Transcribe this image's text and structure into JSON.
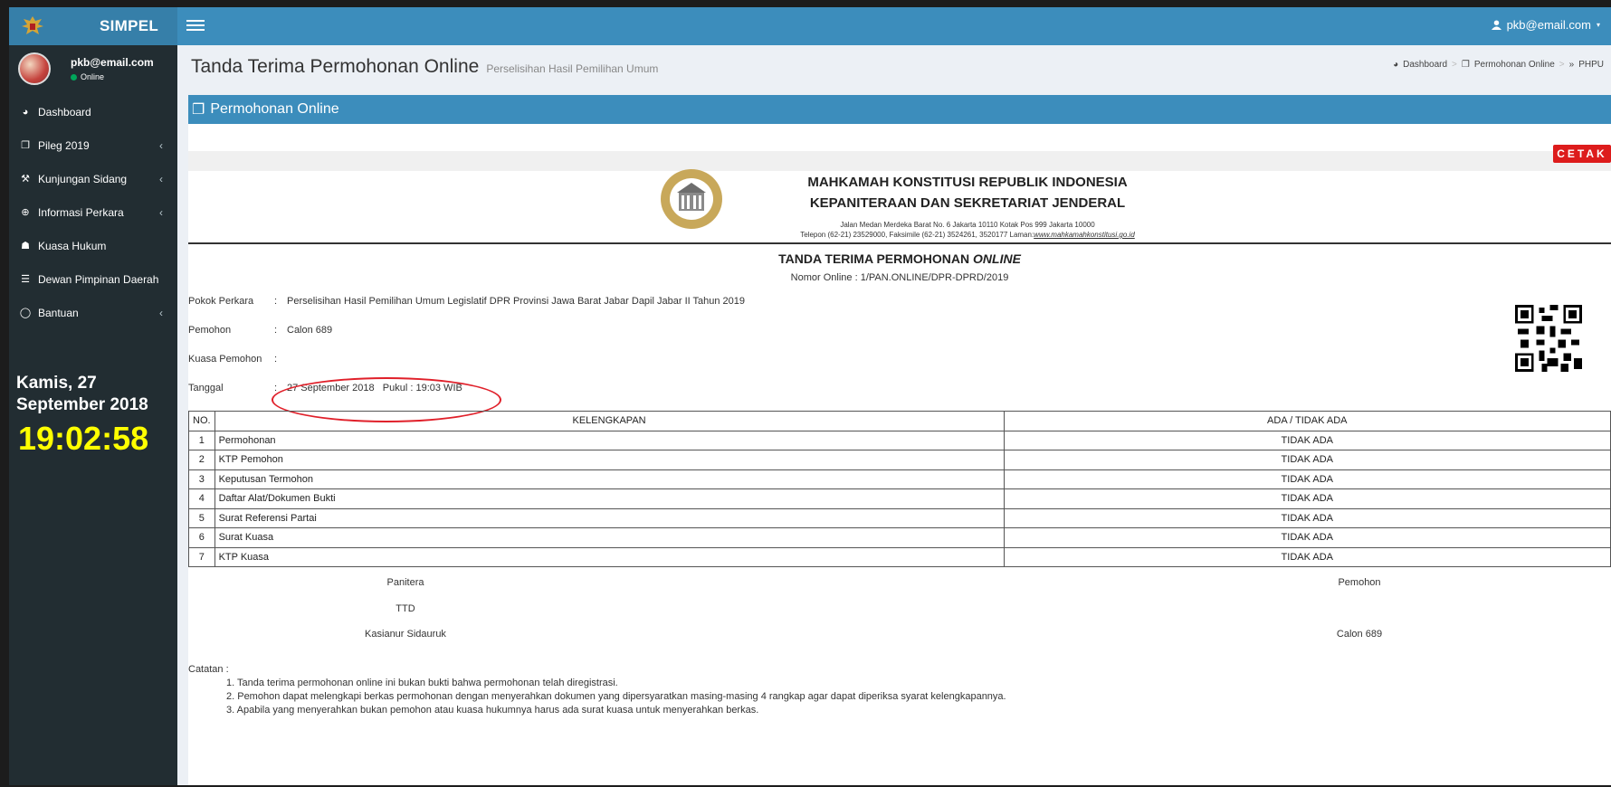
{
  "app": {
    "brand": "SIMPEL"
  },
  "header": {
    "user": "pkb@email.com"
  },
  "sidebar": {
    "user_name": "pkb@email.com",
    "user_status": "Online",
    "items": [
      {
        "label": "Dashboard",
        "icon": "dashboard-icon"
      },
      {
        "label": "Pileg 2019",
        "icon": "copy-icon"
      },
      {
        "label": "Kunjungan Sidang",
        "icon": "gavel-icon"
      },
      {
        "label": "Informasi Perkara",
        "icon": "search-icon"
      },
      {
        "label": "Kuasa Hukum",
        "icon": "users-icon"
      },
      {
        "label": "Dewan Pimpinan Daerah",
        "icon": "list-icon"
      },
      {
        "label": "Bantuan",
        "icon": "chat-icon"
      }
    ],
    "date_line1": "Kamis, 27",
    "date_line2": "September 2018",
    "clock": "19:02:58"
  },
  "page": {
    "title": "Tanda Terima Permohonan Online",
    "subtitle": "Perselisihan Hasil Pemilihan Umum",
    "breadcrumb": [
      "Dashboard",
      "Permohonan Online",
      "PHPU"
    ]
  },
  "box": {
    "title": "Permohonan Online",
    "print_label": "CETAK"
  },
  "doc": {
    "inst_line1": "MAHKAMAH KONSTITUSI REPUBLIK INDONESIA",
    "inst_line2": "KEPANITERAAN DAN SEKRETARIAT JENDERAL",
    "address": "Jalan Medan Merdeka Barat No. 6 Jakarta 10110 Kotak Pos 999 Jakarta 10000",
    "phone": "Telepon (62-21) 23529000, Faksimile (62-21) 3524261, 3520177 Laman:",
    "website": "www.mahkamahkonstitusi.go.id",
    "title_main": "TANDA TERIMA PERMOHONAN ",
    "title_italic": "ONLINE",
    "number": "Nomor Online : 1/PAN.ONLINE/DPR-DPRD/2019",
    "fields": [
      {
        "label": "Pokok Perkara",
        "value": "Perselisihan Hasil Pemilihan Umum Legislatif DPR Provinsi Jawa Barat Jabar Dapil Jabar II Tahun 2019"
      },
      {
        "label": "Pemohon",
        "value": "Calon 689"
      },
      {
        "label": "Kuasa Pemohon",
        "value": ""
      },
      {
        "label": "Tanggal",
        "value": "27 September 2018   Pukul : 19:03 WIB"
      }
    ],
    "table": {
      "headers": [
        "NO.",
        "KELENGKAPAN",
        "ADA / TIDAK ADA"
      ],
      "rows": [
        {
          "no": "1",
          "item": "Permohonan",
          "status": "TIDAK ADA"
        },
        {
          "no": "2",
          "item": "KTP Pemohon",
          "status": "TIDAK ADA"
        },
        {
          "no": "3",
          "item": "Keputusan Termohon",
          "status": "TIDAK ADA"
        },
        {
          "no": "4",
          "item": "Daftar Alat/Dokumen Bukti",
          "status": "TIDAK ADA"
        },
        {
          "no": "5",
          "item": "Surat Referensi Partai",
          "status": "TIDAK ADA"
        },
        {
          "no": "6",
          "item": "Surat Kuasa",
          "status": "TIDAK ADA"
        },
        {
          "no": "7",
          "item": "KTP Kuasa",
          "status": "TIDAK ADA"
        }
      ]
    },
    "signature": {
      "left_title": "Panitera",
      "left_ttd": "TTD",
      "left_name": "Kasianur Sidauruk",
      "right_title": "Pemohon",
      "right_name": "Calon 689"
    },
    "notes_label": "Catatan :",
    "notes": [
      "1. Tanda terima permohonan online ini bukan bukti bahwa permohonan telah diregistrasi.",
      "2. Pemohon dapat melengkapi berkas permohonan dengan menyerahkan dokumen yang dipersyaratkan masing-masing 4 rangkap agar dapat diperiksa syarat kelengkapannya.",
      "3. Apabila yang menyerahkan bukan pemohon atau kuasa hukumnya harus ada surat kuasa untuk menyerahkan berkas."
    ]
  },
  "colors": {
    "header": "#3c8dbc",
    "sidebar": "#222d32",
    "print_button": "#dd1c1c",
    "clock": "#ffff00"
  }
}
